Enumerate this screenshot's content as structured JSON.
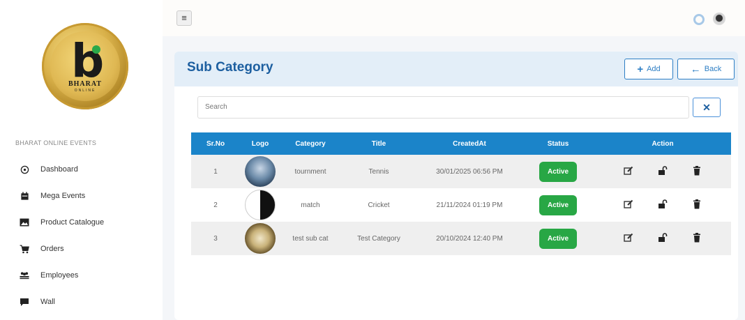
{
  "brand": {
    "logo_letter": "b",
    "logo_name": "BHARAT",
    "logo_sub": "ONLINE"
  },
  "sidebar": {
    "section_label": "BHARAT ONLINE EVENTS",
    "items": [
      {
        "label": "Dashboard",
        "icon": "dashboard-icon"
      },
      {
        "label": "Mega Events",
        "icon": "calendar-icon"
      },
      {
        "label": "Product Catalogue",
        "icon": "image-icon"
      },
      {
        "label": "Orders",
        "icon": "cart-icon"
      },
      {
        "label": "Employees",
        "icon": "users-icon"
      },
      {
        "label": "Wall",
        "icon": "chat-icon"
      }
    ]
  },
  "topbar": {
    "menu_icon": "hamburger-icon"
  },
  "page": {
    "title": "Sub Category",
    "add_label": "Add",
    "back_label": "Back",
    "search_placeholder": "Search",
    "clear_symbol": "✕"
  },
  "table": {
    "headers": [
      "Sr.No",
      "Logo",
      "Category",
      "Title",
      "CreatedAt",
      "Status",
      "Action"
    ],
    "rows": [
      {
        "sr": "1",
        "category": "tournment",
        "title": "Tennis",
        "created": "30/01/2025 06:56 PM",
        "status": "Active"
      },
      {
        "sr": "2",
        "category": "match",
        "title": "Cricket",
        "created": "21/11/2024 01:19 PM",
        "status": "Active"
      },
      {
        "sr": "3",
        "category": "test sub cat",
        "title": "Test Category",
        "created": "20/10/2024 12:40 PM",
        "status": "Active"
      }
    ]
  },
  "colors": {
    "accent": "#1b84c9",
    "title": "#1d5fa0",
    "active_badge": "#28a745",
    "header_band": "#e3eef8"
  }
}
